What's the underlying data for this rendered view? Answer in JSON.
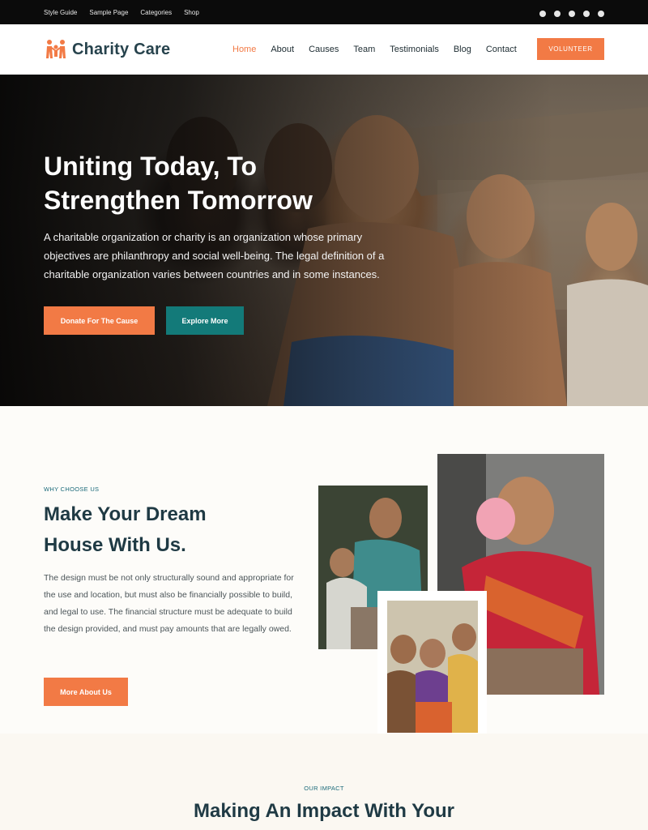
{
  "topbar": {
    "links": [
      "Style Guide",
      "Sample Page",
      "Categories",
      "Shop"
    ],
    "social_icons": [
      "facebook-icon",
      "twitter-icon",
      "instagram-icon",
      "globe-icon",
      "pinterest-icon"
    ]
  },
  "header": {
    "logo_text": "Charity Care",
    "nav": [
      "Home",
      "About",
      "Causes",
      "Team",
      "Testimonials",
      "Blog",
      "Contact"
    ],
    "active_nav": "Home",
    "cta": "VOLUNTEER"
  },
  "hero": {
    "title": "Uniting Today, To Strengthen Tomorrow",
    "text": "A charitable organization or charity is an organization whose primary objectives are philanthropy and social well-being. The legal definition of a charitable organization varies between countries and in some instances.",
    "primary_button": "Donate For The Cause",
    "secondary_button": "Explore More"
  },
  "why": {
    "eyebrow": "WHY CHOOSE US",
    "title": "Make Your Dream House With Us.",
    "text": "The design must be not only structurally sound and appropriate for the use and location, but must also be financially possible to build, and legal to use. The financial structure must be adequate to build the design provided, and must pay amounts that are legally owed.",
    "button": "More About Us"
  },
  "impact": {
    "eyebrow": "OUR IMPACT",
    "title": "Making An Impact With Your"
  },
  "colors": {
    "accent": "#f27a45",
    "teal": "#137a79",
    "heading": "#1f3a44"
  }
}
